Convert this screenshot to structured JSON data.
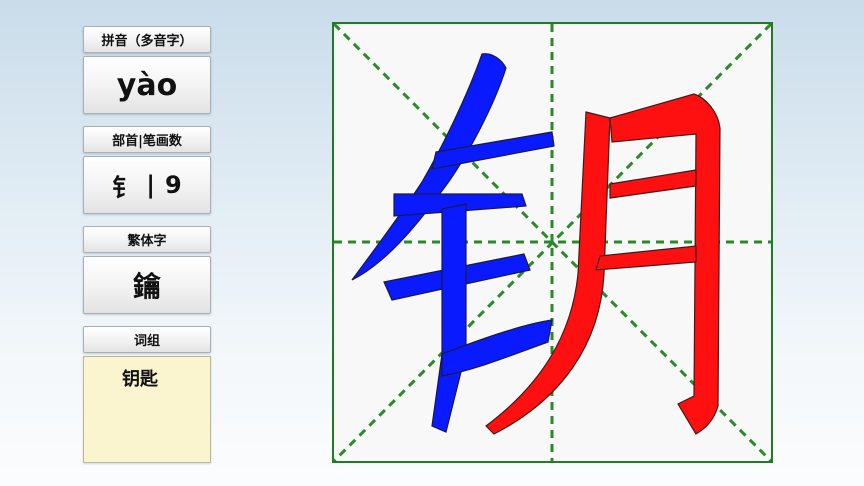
{
  "pinyin": {
    "header": "拼音（多音字）",
    "value": "yào"
  },
  "radical": {
    "header": "部首|笔画数",
    "radical": "钅",
    "separator": "|",
    "strokes": "9"
  },
  "traditional": {
    "header": "繁体字",
    "value": "鑰"
  },
  "words": {
    "header": "词组",
    "items": [
      "钥匙"
    ]
  },
  "character": {
    "glyph": "钥",
    "colors": {
      "radical": "#0a1aff",
      "component": "#ff1010",
      "grid": "#1e7d1e",
      "guides": "#2a8a2a"
    }
  }
}
